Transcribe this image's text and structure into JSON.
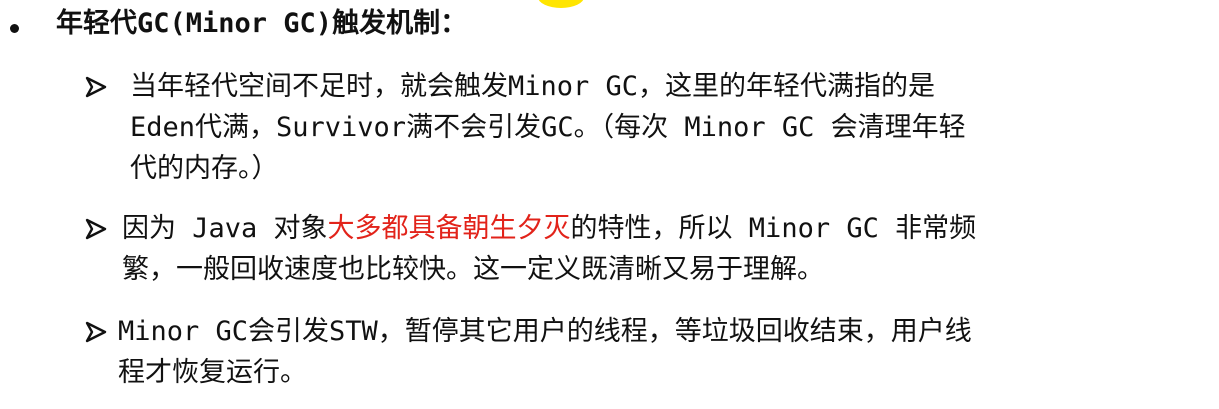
{
  "heading": {
    "text": "年轻代GC(Minor GC)触发机制："
  },
  "items": [
    {
      "lines": [
        "当年轻代空间不足时，就会触发Minor GC，这里的年轻代满指的是",
        "Eden代满，Survivor满不会引发GC。（每次 Minor GC 会清理年轻",
        "代的内存。）"
      ]
    },
    {
      "line1_before": "因为 Java 对象",
      "line1_highlight": "大多都具备朝生夕灭",
      "line1_after": "的特性，所以 Minor GC 非常频",
      "line2": "繁，一般回收速度也比较快。这一定义既清晰又易于理解。"
    },
    {
      "lines": [
        "Minor GC会引发STW，暂停其它用户的线程，等垃圾回收结束，用户线",
        "程才恢复运行。"
      ]
    }
  ],
  "colors": {
    "text": "#111111",
    "highlight_text": "#e2231a",
    "top_marker": "#ffe500"
  },
  "icons": {
    "top_bullet": "filled-circle-bullet-icon",
    "sub_bullet": "arrowhead-bullet-icon"
  }
}
